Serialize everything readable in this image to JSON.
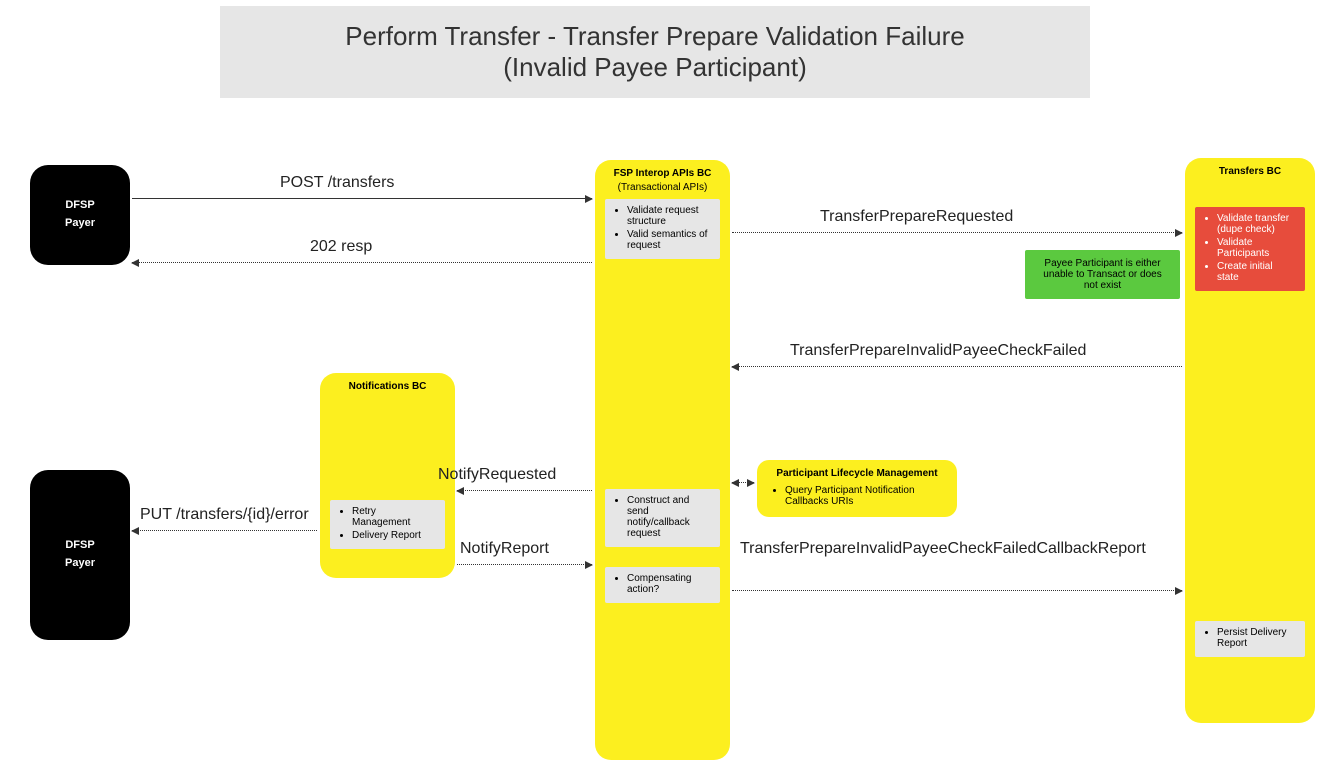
{
  "title": {
    "line1": "Perform Transfer - Transfer Prepare Validation Failure",
    "line2": "(Invalid Payee Participant)"
  },
  "actors": {
    "payer1": {
      "line1": "DFSP",
      "line2": "Payer"
    },
    "payer2": {
      "line1": "DFSP",
      "line2": "Payer"
    }
  },
  "fsp_bc": {
    "title": "FSP Interop APIs BC",
    "subtitle": "(Transactional APIs)",
    "note1": {
      "items": [
        "Validate request structure",
        "Valid semantics of request"
      ]
    },
    "note2": {
      "items": [
        "Construct and send notify/callback request"
      ]
    },
    "note3": {
      "items": [
        "Compensating action?"
      ]
    }
  },
  "transfers_bc": {
    "title": "Transfers BC",
    "red_note": {
      "items": [
        "Validate transfer (dupe check)",
        "Validate Participants",
        "Create initial state"
      ]
    },
    "persist_note": {
      "items": [
        "Persist Delivery Report"
      ]
    }
  },
  "notifications_bc": {
    "title": "Notifications BC",
    "note": {
      "items": [
        "Retry Management",
        "Delivery Report"
      ]
    }
  },
  "participant_lm": {
    "title": "Participant Lifecycle Management",
    "note": {
      "items": [
        "Query Participant Notification Callbacks URIs"
      ]
    }
  },
  "green_note": {
    "text": "Payee Participant is either unable to Transact or does not exist"
  },
  "edges": {
    "post_transfers": "POST /transfers",
    "resp_202": "202 resp",
    "prepare_requested": "TransferPrepareRequested",
    "invalid_check_failed": "TransferPrepareInvalidPayeeCheckFailed",
    "notify_requested": "NotifyRequested",
    "notify_report": "NotifyReport",
    "put_error": "PUT /transfers/{id}/error",
    "callback_report": "TransferPrepareInvalidPayeeCheckFailedCallbackReport"
  }
}
